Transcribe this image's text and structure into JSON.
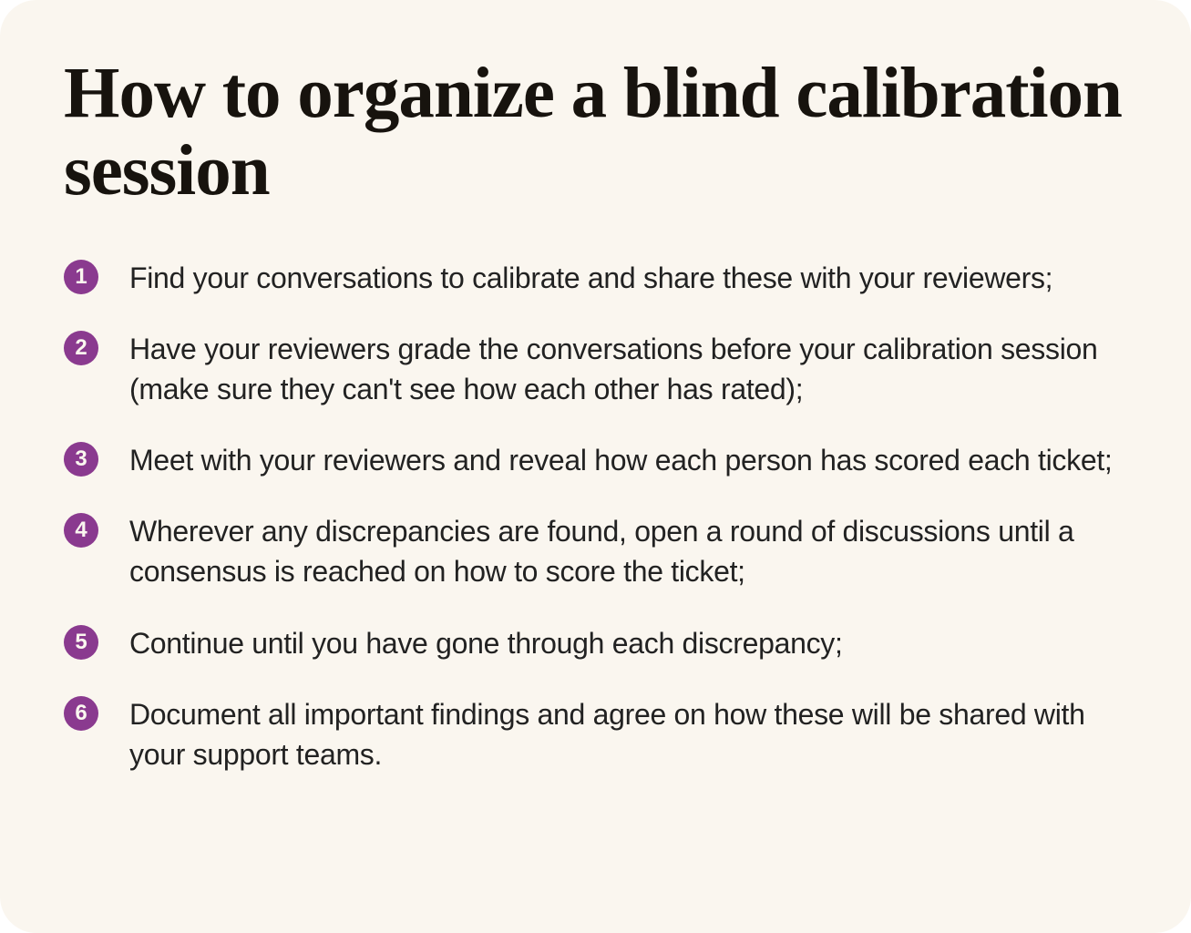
{
  "title": "How to organize a blind calibration session",
  "colors": {
    "badge_bg": "#8a3a8f",
    "card_bg": "#faf6ef",
    "text": "#222222",
    "title": "#17130e"
  },
  "steps": [
    {
      "n": "1",
      "text": "Find your conversations to calibrate and share these with your reviewers;"
    },
    {
      "n": "2",
      "text": "Have your reviewers grade the conversations before your calibration session (make sure they can't see how each other has rated);"
    },
    {
      "n": "3",
      "text": "Meet with your reviewers and reveal how each person has scored each ticket;"
    },
    {
      "n": "4",
      "text": "Wherever any discrepancies are found, open a round of discussions until a consensus is reached on how to score the ticket;"
    },
    {
      "n": "5",
      "text": "Continue until you have gone through each discrepancy;"
    },
    {
      "n": "6",
      "text": "Document all important findings and agree on how these will be shared with your support teams."
    }
  ]
}
